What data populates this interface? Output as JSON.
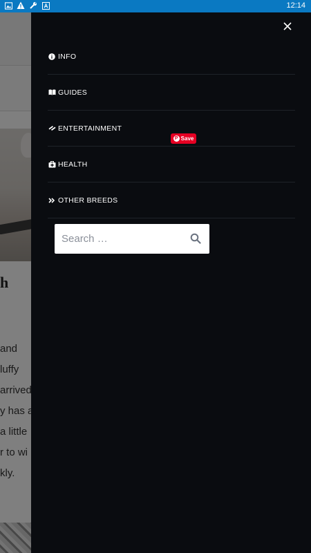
{
  "status_bar": {
    "time": "12:14",
    "icons": [
      "image-icon",
      "warning-icon",
      "wrench-icon",
      "a-icon"
    ]
  },
  "background_page": {
    "title_fragment": "h",
    "paragraph_fragments": [
      "and",
      "luffy",
      "arrived",
      "y has a",
      "a little",
      "r to wi",
      "kly."
    ]
  },
  "drawer": {
    "menu": [
      {
        "label": "INFO",
        "icon": "info-icon"
      },
      {
        "label": "GUIDES",
        "icon": "book-icon"
      },
      {
        "label": "ENTERTAINMENT",
        "icon": "ticket-icon"
      },
      {
        "label": "HEALTH",
        "icon": "medkit-icon"
      },
      {
        "label": "OTHER BREEDS",
        "icon": "double-chevron-right-icon"
      }
    ],
    "pinterest_save_label": "Save",
    "search": {
      "placeholder": "Search …"
    }
  },
  "colors": {
    "status_bar": "#0a79c2",
    "drawer_bg": "#0a0c10",
    "pinterest": "#e60023"
  }
}
